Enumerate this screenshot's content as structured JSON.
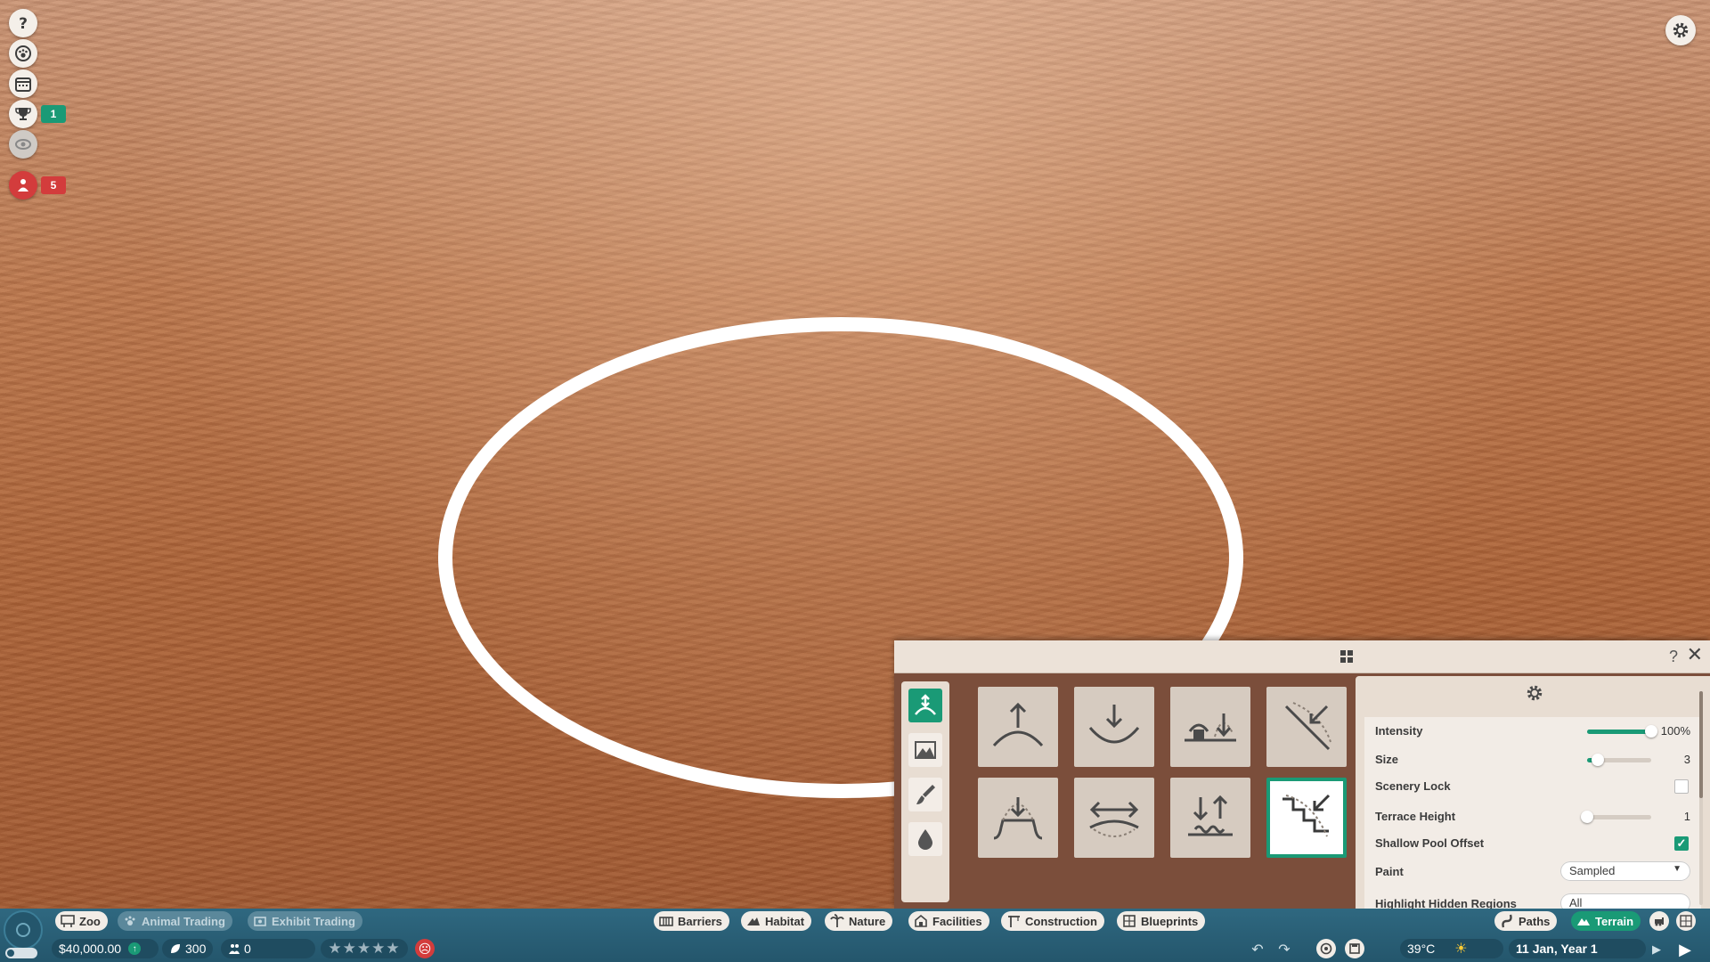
{
  "left_bar": {
    "challenges_count": "1",
    "guests_alert_count": "5"
  },
  "settings": {
    "intensity_label": "Intensity",
    "intensity_value": "100%",
    "intensity_fraction": 1.0,
    "size_label": "Size",
    "size_value": "3",
    "size_fraction": 0.17,
    "scenery_lock_label": "Scenery Lock",
    "scenery_lock_checked": false,
    "terrace_height_label": "Terrace Height",
    "terrace_height_value": "1",
    "terrace_height_fraction": 0.0,
    "shallow_pool_offset_label": "Shallow Pool Offset",
    "shallow_pool_offset_checked": true,
    "paint_label": "Paint",
    "paint_value": "Sampled",
    "highlight_hidden_label": "Highlight Hidden Regions",
    "highlight_hidden_value": "All"
  },
  "tools": {
    "selected_index": 7
  },
  "bottom": {
    "tabs_left": [
      "Zoo",
      "Animal Trading",
      "Exhibit Trading"
    ],
    "tabs_center": [
      "Barriers",
      "Habitat",
      "Nature",
      "Facilities",
      "Construction",
      "Blueprints"
    ],
    "tabs_right": [
      "Paths",
      "Terrain"
    ],
    "money": "$40,000.00",
    "conservation_credits": "300",
    "guests": "0",
    "temperature": "39°C",
    "date": "11 Jan, Year 1"
  },
  "colors": {
    "accent": "#1a9a76",
    "bar": "#2f6880",
    "alert": "#d33c3c"
  }
}
